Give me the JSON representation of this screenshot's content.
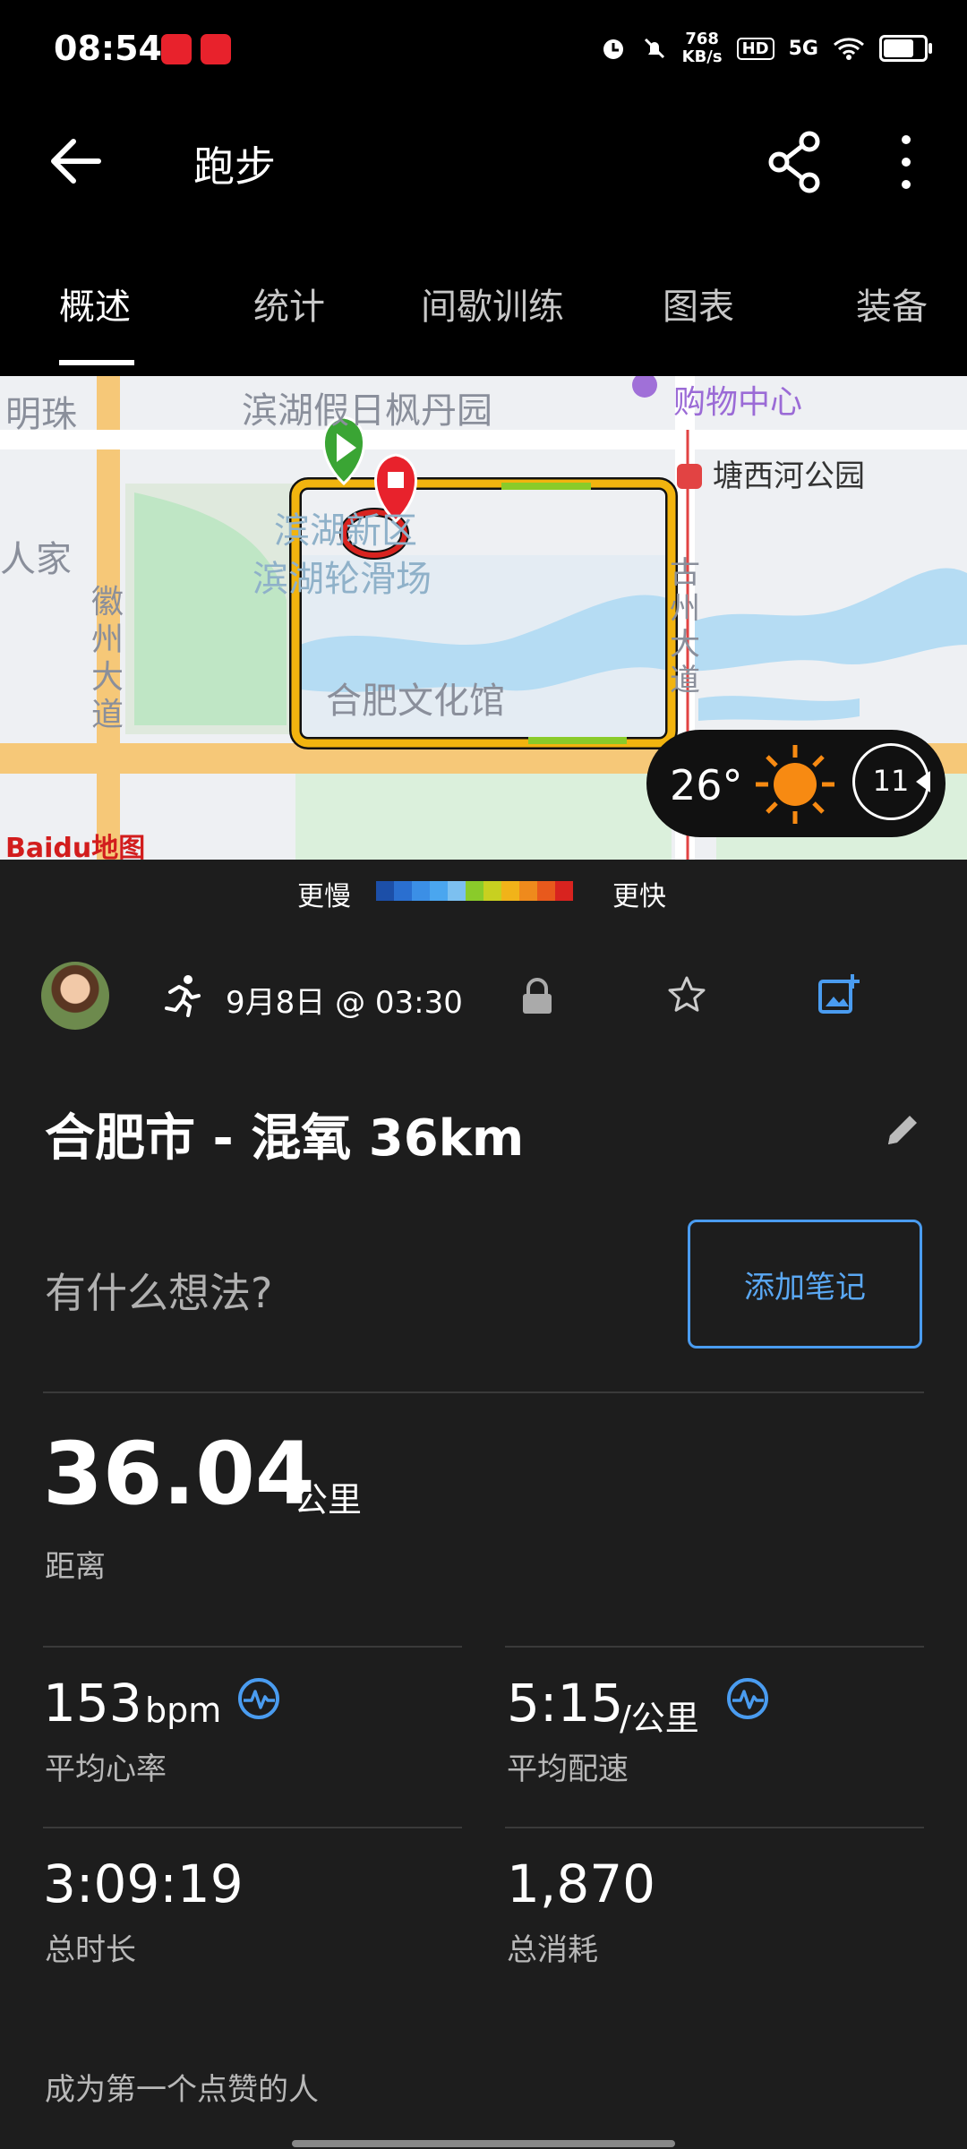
{
  "status_bar": {
    "time": "08:54",
    "speed_value": "768",
    "speed_unit": "KB/s",
    "hd": "HD",
    "network": "5G",
    "battery_level": 0.75
  },
  "app_bar": {
    "title": "跑步",
    "back_icon": "arrow-left-icon",
    "share_icon": "share-icon",
    "more_icon": "more-vertical-icon"
  },
  "tabs": [
    {
      "label": "概述",
      "active": true
    },
    {
      "label": "统计",
      "active": false
    },
    {
      "label": "间歇训练",
      "active": false
    },
    {
      "label": "图表",
      "active": false
    },
    {
      "label": "装备",
      "active": false
    }
  ],
  "map": {
    "labels": {
      "mingzhu": "明珠",
      "binhu_garden": "滨湖假日枫丹园",
      "mall": "购物中心",
      "tangxihe_park": "塘西河公园",
      "renjia": "人家",
      "huizhou_road": "徽州大道",
      "binhu_district": "滨湖新区",
      "skating_rink": "滨湖轮滑场",
      "culture_center": "合肥文化馆",
      "right_road": "古州大道"
    },
    "weather": {
      "temperature": "26°",
      "wind": "11"
    },
    "attribution": "Baidu地图"
  },
  "pace_legend": {
    "slow": "更慢",
    "fast": "更快",
    "colors": [
      "#1c4fa8",
      "#2a6fd0",
      "#3b8fe6",
      "#4aa6ef",
      "#7cc0f0",
      "#8acb2a",
      "#c8d020",
      "#f1b319",
      "#ef8a1c",
      "#e8591c",
      "#d8231f"
    ]
  },
  "activity": {
    "date": "9月8日 @ 03:30",
    "title": "合肥市 - 混氧 36km",
    "note_prompt": "有什么想法?",
    "note_button": "添加笔记",
    "distance": {
      "value": "36.04",
      "unit": "公里",
      "label": "距离"
    },
    "stats": [
      {
        "value": "153",
        "unit": "bpm",
        "label": "平均心率",
        "icon": "pulse-icon"
      },
      {
        "value": "5:15",
        "unit": "/公里",
        "label": "平均配速",
        "icon": "pulse-icon"
      },
      {
        "value": "3:09:19",
        "unit": "",
        "label": "总时长"
      },
      {
        "value": "1,870",
        "unit": "",
        "label": "总消耗"
      }
    ],
    "kudos": "成为第一个点赞的人"
  },
  "colors": {
    "accent": "#4a9cf0",
    "background": "#1d1d1d",
    "route": "#f2b40f",
    "start_marker": "#3aa534",
    "end_marker": "#e8222c"
  }
}
